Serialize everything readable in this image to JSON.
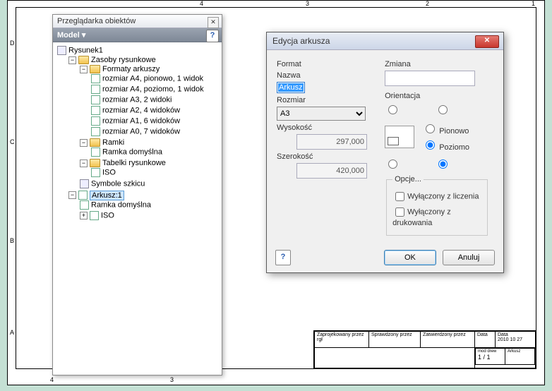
{
  "ruler": {
    "top": [
      "4",
      "3",
      "2",
      "1"
    ],
    "left": [
      "D",
      "C",
      "B",
      "A"
    ]
  },
  "titleblock": {
    "h1": "Zaprojekowany przez",
    "h2": "Sprawdzony przez",
    "h3": "Zatwierdzony przez",
    "h4": "Data",
    "h5": "Data",
    "user": "rgł",
    "date": "2010 10 27",
    "edLab": "mod drew",
    "ed": "1 / 1",
    "shLab": "Arkusz"
  },
  "browser": {
    "title": "Przeglądarka obiektów",
    "subhead": "Model",
    "root": "Rysunek1",
    "folder1": "Zasoby rysunkowe",
    "formats": "Formaty arkuszy",
    "fmt": [
      "rozmiar A4, pionowo, 1 widok",
      "rozmiar A4, poziomo, 1 widok",
      "rozmiar A3, 2 widoki",
      "rozmiar A2, 4 widoków",
      "rozmiar A1, 6 widoków",
      "rozmiar A0, 7 widoków"
    ],
    "ramki": "Ramki",
    "ramkaDef": "Ramka domyślna",
    "tabelki": "Tabelki rysunkowe",
    "iso": "ISO",
    "symbole": "Symbole szkicu",
    "arkusz": "Arkusz:1",
    "ramkaDef2": "Ramka domyślna",
    "iso2": "ISO"
  },
  "dialog": {
    "title": "Edycja arkusza",
    "formatH": "Format",
    "nazwaL": "Nazwa",
    "nazwaV": "Arkusz",
    "rozmiarL": "Rozmiar",
    "rozmiarV": "A3",
    "wysL": "Wysokość",
    "wysV": "297,000",
    "szerL": "Szerokość",
    "szerV": "420,000",
    "zmianaH": "Zmiana",
    "zmianaV": "",
    "orientH": "Orientacja",
    "pionowo": "Pionowo",
    "poziomo": "Poziomo",
    "opcjeH": "Opcje...",
    "opt1": "Wyłączony z liczenia",
    "opt2": "Wyłączony z drukowania",
    "ok": "OK",
    "cancel": "Anuluj"
  }
}
